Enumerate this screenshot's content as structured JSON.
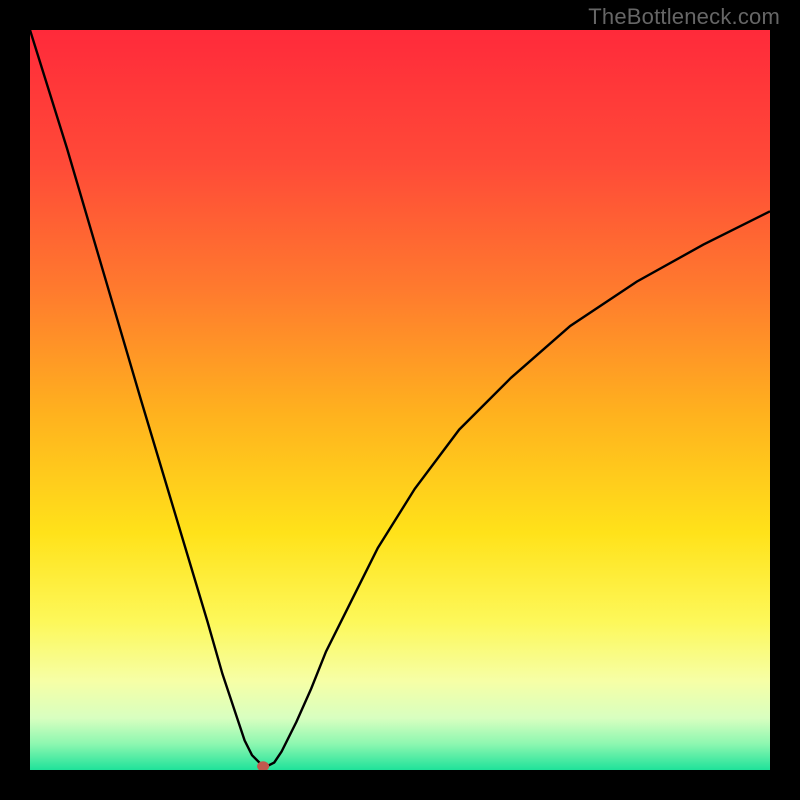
{
  "watermark": "TheBottleneck.com",
  "chart_data": {
    "type": "line",
    "title": "",
    "xlabel": "",
    "ylabel": "",
    "xlim": [
      0,
      100
    ],
    "ylim": [
      0,
      100
    ],
    "series": [
      {
        "name": "bottleneck-curve",
        "x": [
          0,
          5,
          10,
          15,
          18,
          21,
          24,
          26,
          27,
          28,
          29,
          30,
          31,
          31.5,
          32,
          33,
          34,
          36,
          38,
          40,
          43,
          47,
          52,
          58,
          65,
          73,
          82,
          91,
          100
        ],
        "y": [
          100,
          84,
          67,
          50,
          40,
          30,
          20,
          13,
          10,
          7,
          4,
          2,
          1,
          0.5,
          0.5,
          1,
          2.5,
          6.5,
          11,
          16,
          22,
          30,
          38,
          46,
          53,
          60,
          66,
          71,
          75.5
        ]
      }
    ],
    "marker": {
      "x": 31.5,
      "y": 0.5,
      "color": "#c1584e"
    },
    "gradient_stops": [
      {
        "offset": 0.0,
        "color": "#ff2a3a"
      },
      {
        "offset": 0.18,
        "color": "#ff4a38"
      },
      {
        "offset": 0.35,
        "color": "#ff7a2e"
      },
      {
        "offset": 0.52,
        "color": "#ffb21e"
      },
      {
        "offset": 0.68,
        "color": "#ffe21a"
      },
      {
        "offset": 0.8,
        "color": "#fdf85a"
      },
      {
        "offset": 0.88,
        "color": "#f6ffa6"
      },
      {
        "offset": 0.93,
        "color": "#d8ffc0"
      },
      {
        "offset": 0.965,
        "color": "#8cf7b0"
      },
      {
        "offset": 1.0,
        "color": "#1fe29a"
      }
    ]
  }
}
